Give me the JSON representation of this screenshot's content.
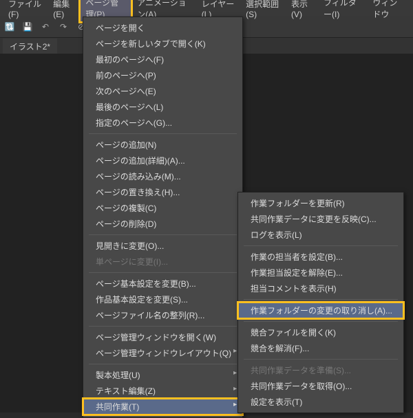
{
  "menubar": {
    "items": [
      "ファイル(F)",
      "編集(E)",
      "ページ管理(P)",
      "アニメーション(A)",
      "レイヤー(L)",
      "選択範囲(S)",
      "表示(V)",
      "フィルター(I)",
      "ウィンドウ"
    ]
  },
  "tab": {
    "label": "イラスト2*"
  },
  "menu1": {
    "g1": [
      "ページを開く",
      "ページを新しいタブで開く(K)",
      "最初のページへ(F)",
      "前のページへ(P)",
      "次のページへ(E)",
      "最後のページへ(L)",
      "指定のページへ(G)..."
    ],
    "g2": [
      "ページの追加(N)",
      "ページの追加(詳細)(A)...",
      "ページの読み込み(M)...",
      "ページの置き換え(H)...",
      "ページの複製(C)",
      "ページの削除(D)"
    ],
    "g3": [
      "見開きに変更(O)..."
    ],
    "g3d": [
      "単ページに変更(I)..."
    ],
    "g4": [
      "ページ基本設定を変更(B)...",
      "作品基本設定を変更(S)...",
      "ページファイル名の整列(R)..."
    ],
    "g5": [
      "ページ管理ウィンドウを開く(W)"
    ],
    "g5s": [
      "ページ管理ウィンドウレイアウト(Q)"
    ],
    "g6s": [
      "製本処理(U)",
      "テキスト編集(Z)"
    ],
    "hi": "共同作業(T)"
  },
  "menu2": {
    "g1": [
      "作業フォルダーを更新(R)",
      "共同作業データに変更を反映(C)...",
      "ログを表示(L)"
    ],
    "g2": [
      "作業の担当者を設定(B)...",
      "作業担当設定を解除(E)...",
      "担当コメントを表示(H)"
    ],
    "hi": "作業フォルダーの変更の取り消し(A)...",
    "g3": [
      "競合ファイルを開く(K)",
      "競合を解消(F)..."
    ],
    "g4d": [
      "共同作業データを準備(S)..."
    ],
    "g4": [
      "共同作業データを取得(O)...",
      "設定を表示(T)"
    ]
  }
}
